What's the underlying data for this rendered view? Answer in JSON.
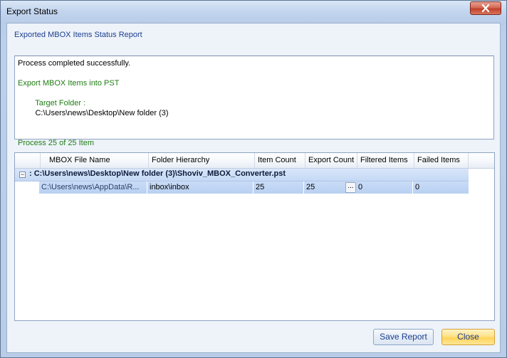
{
  "window": {
    "title": "Export Status",
    "close_icon": "close-x-icon"
  },
  "report": {
    "title": "Exported MBOX Items Status Report",
    "log": {
      "line1": "Process completed successfully.",
      "line2": "Export MBOX Items into PST",
      "target_label": "Target Folder :",
      "target_value": "C:\\Users\\news\\Desktop\\New folder (3)",
      "progress": "Process 25 of 25 Item"
    }
  },
  "grid": {
    "columns": [
      "MBOX File Name",
      "Folder Hierarchy",
      "Item Count",
      "Export Count",
      "Filtered Items",
      "Failed Items"
    ],
    "group": {
      "expand_symbol": "−",
      "label": ": C:\\Users\\news\\Desktop\\New folder (3)\\Shoviv_MBOX_Converter.pst"
    },
    "rows": [
      {
        "mbox_file": "C:\\Users\\news\\AppData\\R...",
        "folder": "inbox\\inbox",
        "item_count": "25",
        "export_count": "25",
        "ellipsis": "...",
        "filtered": "0",
        "failed": "0"
      }
    ]
  },
  "buttons": {
    "save_report": "Save Report",
    "close": "Close"
  },
  "colors": {
    "accent_text": "#1b3f8f",
    "success_text": "#1e7d12",
    "close_button_bg": "#ffd45a",
    "title_close_bg": "#c1402b"
  }
}
